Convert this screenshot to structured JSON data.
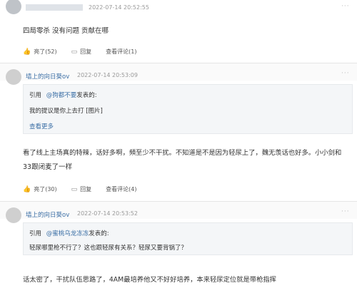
{
  "comments": [
    {
      "user": "",
      "time": "2022-07-14 20:52:55",
      "text": "四局零杀 没有问题 贡献在哪",
      "like": "亮了(52)",
      "reply": "回复",
      "view": "查看评论(1)"
    },
    {
      "user": "墙上的向日葵ov",
      "time": "2022-07-14 20:53:09",
      "quote_prefix": "引用",
      "quote_user": "@狗都不要",
      "quote_suffix": "发表的:",
      "quote_text": "我的提议是你上去打 [图片]",
      "quote_more": "查看更多",
      "text_line1": "看了线上主场真的特辣，话好多啊，頻至少不干扰。不知道是不是因为轻尿上了，魏无羡话也好多。小小剑和",
      "text_line2": "33跟闭麦了一样",
      "like": "亮了(30)",
      "reply": "回复",
      "view": "查看评论(4)"
    },
    {
      "user": "墙上的向日葵ov",
      "time": "2022-07-14 20:53:52",
      "quote_prefix": "引用",
      "quote_user": "@蜜桃乌龙冻冻",
      "quote_suffix": "发表的:",
      "quote_text": "轻尿哪里枪不行了？这也跟轻尿有关系？轻尿又要背锅了？",
      "text_line1": "话太密了，干扰队伍思路了，4AM最培养他又不好好培养，本来轻尿定位就是带枪指挥"
    }
  ],
  "more_glyph": "···"
}
